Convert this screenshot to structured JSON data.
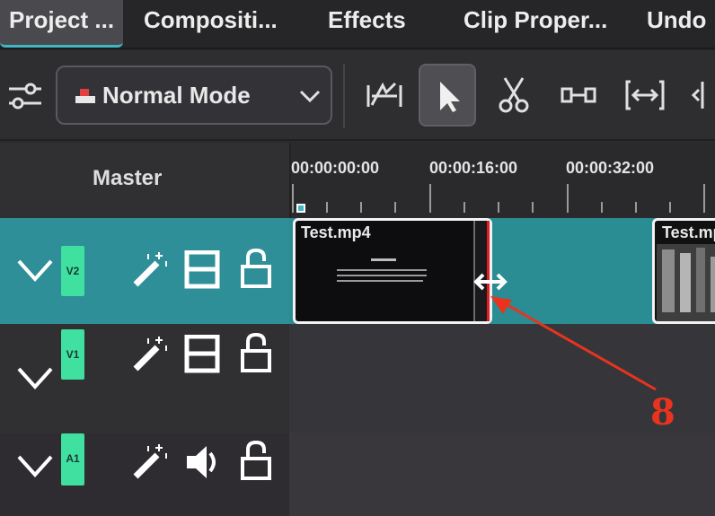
{
  "tabs": [
    {
      "label": "Project ..."
    },
    {
      "label": "Compositi..."
    },
    {
      "label": "Effects"
    },
    {
      "label": "Clip Proper..."
    },
    {
      "label": "Undo"
    }
  ],
  "toolbar": {
    "mode_label": "Normal Mode",
    "tools": [
      "trim-slip-icon",
      "select-arrow-icon",
      "razor-cut-icon",
      "spacer-icon",
      "ripple-icon",
      "roll-icon"
    ]
  },
  "header": {
    "master_label": "Master",
    "timecodes": [
      "00:00:00:00",
      "00:00:16:00",
      "00:00:32:00"
    ]
  },
  "tracks": [
    {
      "name": "V2",
      "type": "video"
    },
    {
      "name": "V1",
      "type": "video"
    },
    {
      "name": "A1",
      "type": "audio"
    }
  ],
  "clips": [
    {
      "title": "Test.mp4"
    },
    {
      "title": "Test.mp4"
    }
  ],
  "annotation": {
    "label": "8",
    "color": "#e8341e"
  },
  "colors": {
    "selected_track": "#2e8f98",
    "track_badge": "#3fe0a0",
    "accent": "#3fb6c4"
  }
}
